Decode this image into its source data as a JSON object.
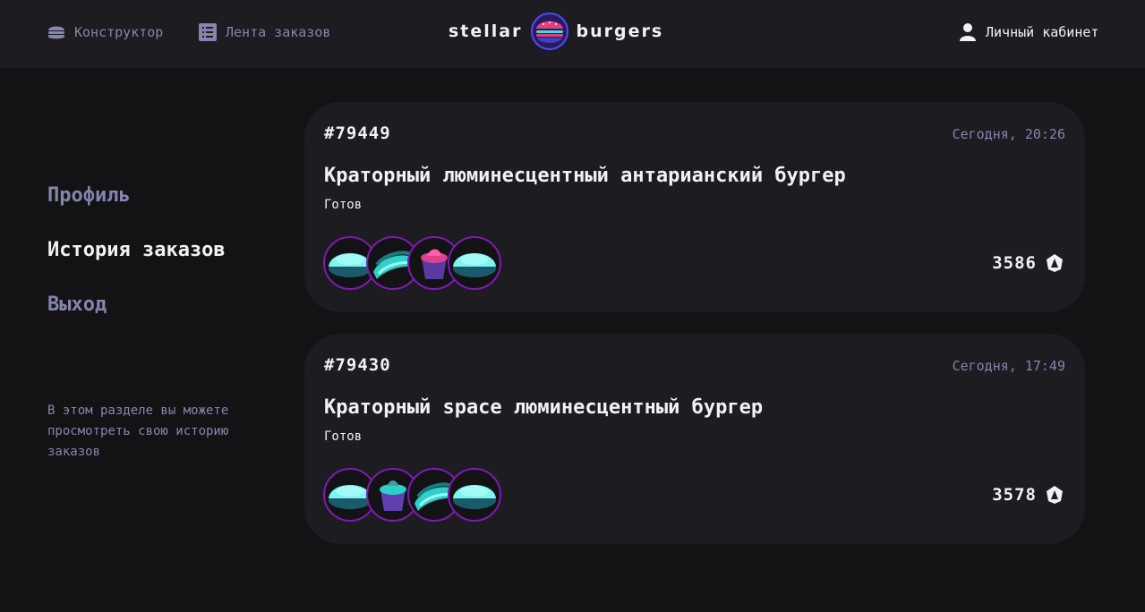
{
  "header": {
    "constructor_label": "Конструктор",
    "feed_label": "Лента заказов",
    "logo_left": "stellar",
    "logo_right": "burgers",
    "account_label": "Личный кабинет"
  },
  "sidebar": {
    "items": [
      {
        "label": "Профиль"
      },
      {
        "label": "История заказов"
      },
      {
        "label": "Выход"
      }
    ],
    "hint": "В этом разделе вы можете просмотреть свою историю заказов"
  },
  "orders": [
    {
      "number": "#79449",
      "date": "Сегодня, 20:26",
      "name": "Краторный люминесцентный антарианский бургер",
      "status": "Готов",
      "price": "3586",
      "ingredients": [
        "bun-icon",
        "meat-icon",
        "sauce-icon",
        "bun-icon"
      ]
    },
    {
      "number": "#79430",
      "date": "Сегодня, 17:49",
      "name": "Краторный space люминесцентный бургер",
      "status": "Готов",
      "price": "3578",
      "ingredients": [
        "bun-icon",
        "sauce-icon",
        "meat-icon",
        "bun-icon"
      ]
    }
  ],
  "colors": {
    "background": "#131316",
    "card": "#1c1c21",
    "accent_border": "#801ab2",
    "muted_text": "#8585ad",
    "text": "#f2f2f3"
  }
}
